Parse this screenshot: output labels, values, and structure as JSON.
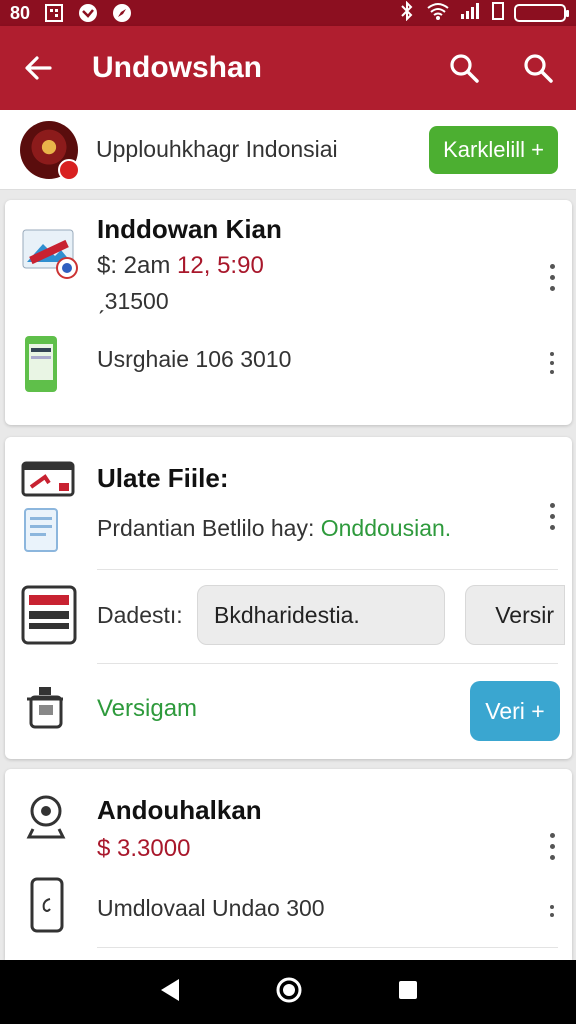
{
  "status_bar": {
    "time": "80",
    "icons": [
      "qr-icon",
      "shield-icon",
      "compass-icon"
    ],
    "right_icons": [
      "bluetooth-icon",
      "wifi-icon",
      "signal-icon",
      "battery-icon"
    ]
  },
  "app_bar": {
    "title": "Undowshan",
    "back_icon": "back-arrow-icon",
    "actions": [
      "search-icon",
      "search-icon"
    ]
  },
  "banner": {
    "text": "Upplouhkhagr Indonsiai",
    "button_label": "Karklelill +"
  },
  "card1": {
    "title": "Inddowan Kian",
    "price_prefix": "$: 2am",
    "price_red": "12, 5:90",
    "sub": "ˏ31500",
    "row2_text": "Usrghaie 106 3010"
  },
  "card2": {
    "title": "Ulate Fiile:",
    "desc_prefix": "Prdantian Betlilo hay: ",
    "desc_green": "Onddousian.",
    "field_label": "Dadestı:",
    "field_value": "Bkdharidestia.",
    "field_value2": "Versir",
    "green_label": "Versigam",
    "blue_button": "Veri +"
  },
  "card3": {
    "title": "Andouhalkan",
    "price": "$ 3.3000",
    "row2_text": "Umdlovaal Undao 300"
  },
  "nav": {
    "back": "back-triangle-icon",
    "home": "home-circle-icon",
    "recents": "recents-square-icon"
  },
  "colors": {
    "primary": "#b01e2f",
    "status": "#8c0f20",
    "green": "#4caf31",
    "blue": "#3aa6d0"
  }
}
